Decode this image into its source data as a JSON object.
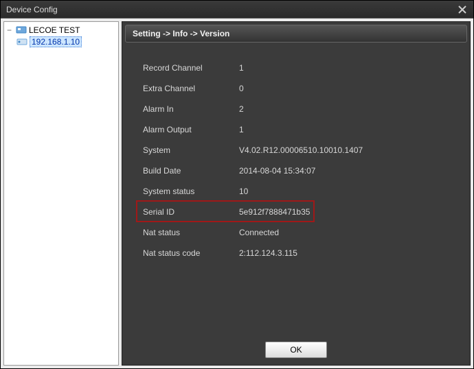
{
  "window": {
    "title": "Device Config"
  },
  "sidebar": {
    "root_label": "LECOE TEST",
    "child_label": "192.168.1.10"
  },
  "breadcrumb": "Setting -> Info -> Version",
  "info": {
    "rows": [
      {
        "label": "Record Channel",
        "value": "1"
      },
      {
        "label": "Extra Channel",
        "value": "0"
      },
      {
        "label": "Alarm In",
        "value": "2"
      },
      {
        "label": "Alarm Output",
        "value": "1"
      },
      {
        "label": "System",
        "value": "V4.02.R12.00006510.10010.1407"
      },
      {
        "label": "Build Date",
        "value": "2014-08-04 15:34:07"
      },
      {
        "label": "System status",
        "value": "10"
      },
      {
        "label": "Serial ID",
        "value": "5e912f7888471b35"
      },
      {
        "label": "Nat status",
        "value": "Connected"
      },
      {
        "label": "Nat status code",
        "value": "2:112.124.3.115"
      }
    ],
    "highlight_index": 7
  },
  "buttons": {
    "ok": "OK"
  }
}
